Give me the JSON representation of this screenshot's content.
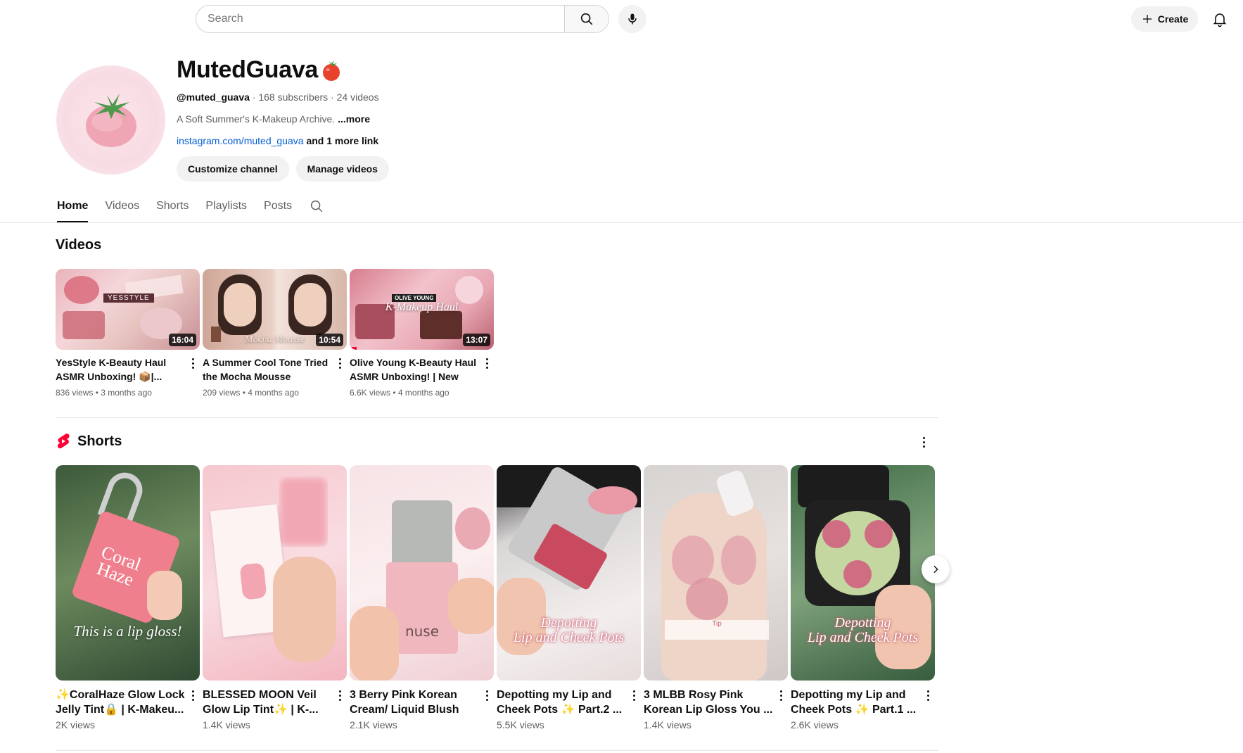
{
  "topbar": {
    "search_placeholder": "Search",
    "create_label": "Create"
  },
  "channel": {
    "name": "MutedGuava",
    "name_emoji": "tomato",
    "handle": "@muted_guava",
    "subscribers": "168 subscribers",
    "video_count": "24 videos",
    "separator": "·",
    "description": "A Soft Summer's K-Makeup Archive.",
    "more_label": "...more",
    "link_text": "instagram.com/muted_guava",
    "more_links": "and 1 more link",
    "customize_label": "Customize channel",
    "manage_label": "Manage videos"
  },
  "tabs": [
    {
      "label": "Home",
      "active": true
    },
    {
      "label": "Videos",
      "active": false
    },
    {
      "label": "Shorts",
      "active": false
    },
    {
      "label": "Playlists",
      "active": false
    },
    {
      "label": "Posts",
      "active": false
    }
  ],
  "videos_section": {
    "title": "Videos",
    "items": [
      {
        "title_line1": "YesStyle K-Beauty Haul",
        "title_line2": "ASMR Unboxing! 📦|...",
        "meta": "836 views • 3 months ago",
        "duration": "16:04",
        "thumb_text": "YESSTYLE",
        "watched": 0.0
      },
      {
        "title_line1": "A Summer Cool Tone Tried",
        "title_line2": "the Mocha Mousse Makeup...",
        "meta": "209 views • 4 months ago",
        "duration": "10:54",
        "thumb_text": "Mocha Mousse",
        "watched": 0.0
      },
      {
        "title_line1": "Olive Young K-Beauty Haul",
        "title_line2": "ASMR Unboxing! | New K-...",
        "meta": "6.6K views • 4 months ago",
        "duration": "13:07",
        "thumb_text": "K-Makeup Haul",
        "thumb_badge": "OLIVE YOUNG",
        "watched": 0.05
      }
    ]
  },
  "shorts_section": {
    "title": "Shorts",
    "items": [
      {
        "title_line1": "✨CoralHaze Glow Lock",
        "title_line2": "Jelly Tint🔒 | K-Makeu...",
        "views": "2K views",
        "caption": "This is a lip gloss!"
      },
      {
        "title_line1": "BLESSED MOON Veil",
        "title_line2": "Glow Lip Tint✨ | K-...",
        "views": "1.4K views",
        "caption": ""
      },
      {
        "title_line1": "3 Berry Pink Korean",
        "title_line2": "Cream/ Liquid Blush🍓...",
        "views": "2.1K views",
        "caption": "nuse"
      },
      {
        "title_line1": "Depotting my Lip and",
        "title_line2": "Cheek Pots ✨ Part.2 ...",
        "views": "5.5K views",
        "caption": "Depotting\nLip and Cheek Pots"
      },
      {
        "title_line1": "3 MLBB Rosy Pink",
        "title_line2": "Korean Lip Gloss You ...",
        "views": "1.4K views",
        "caption": "Tip"
      },
      {
        "title_line1": "Depotting my Lip and",
        "title_line2": "Cheek Pots ✨ Part.1 ...",
        "views": "2.6K views",
        "caption": "Depotting\nLip and Cheek Pots"
      }
    ]
  },
  "colors": {
    "link": "#065fd4",
    "shorts_red": "#ff0033",
    "muted_text": "#606060",
    "pill_bg": "#f2f2f2"
  },
  "icons": [
    "search-icon",
    "mic-icon",
    "plus-icon",
    "bell-icon",
    "tab-search-icon",
    "shorts-logo-icon",
    "chevron-right-icon",
    "kebab-icon"
  ]
}
